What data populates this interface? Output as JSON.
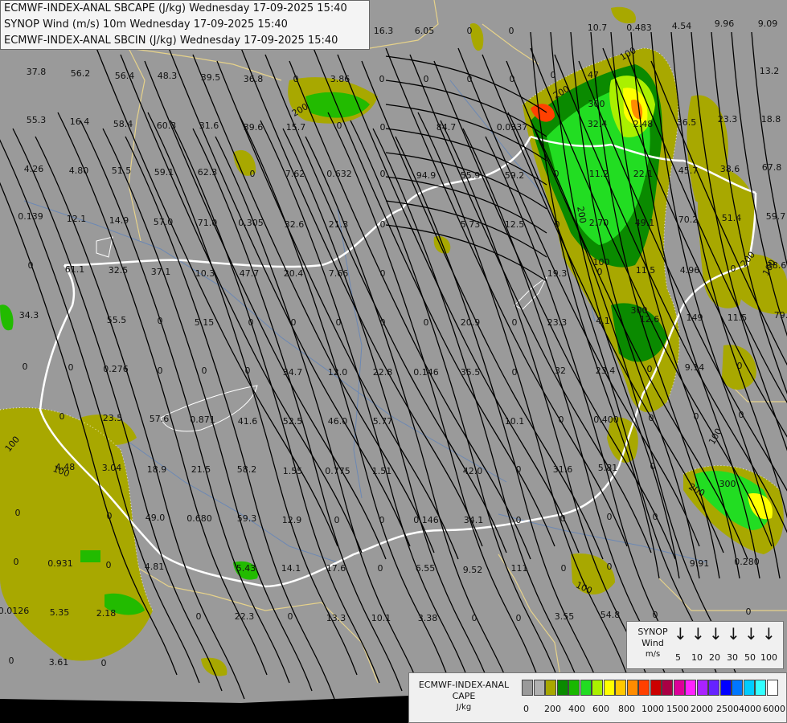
{
  "header": {
    "line1": "ECMWF-INDEX-ANAL SBCAPE (J/kg) Wednesday 17-09-2025 15:40",
    "line2": "SYNOP Wind (m/s) 10m Wednesday 17-09-2025 15:40",
    "line3": "ECMWF-INDEX-ANAL SBCIN (J/kg) Wednesday 17-09-2025 15:40"
  },
  "synop_legend": {
    "title_lines": [
      "SYNOP",
      "Wind",
      "m/s"
    ],
    "values": [
      "5",
      "10",
      "20",
      "30",
      "50",
      "100"
    ]
  },
  "cape_legend": {
    "title_lines": [
      "ECMWF-INDEX-ANAL",
      "CAPE",
      "J/kg"
    ],
    "ticks": [
      "0",
      "200",
      "400",
      "600",
      "800",
      "1000",
      "1500",
      "2000",
      "2500",
      "4000",
      "6000"
    ],
    "colors": [
      "#9a9a9a",
      "#b0b0b0",
      "#a8a800",
      "#0a8a00",
      "#19b800",
      "#22dd22",
      "#aaf000",
      "#ffff00",
      "#ffc800",
      "#ff8c00",
      "#ff4000",
      "#cc0000",
      "#aa0044",
      "#dd0099",
      "#ff22ff",
      "#aa22ff",
      "#6622ff",
      "#0000ff",
      "#0077ff",
      "#00ccff",
      "#33ffff",
      "#ffffff"
    ]
  },
  "colors": {
    "background": "#9a9a9a",
    "cape_low": "#a8a800",
    "cape_mid": "#22cc00",
    "cape_high": "#ffff00",
    "cape_peak": "#ff6600",
    "border": "#ffffff",
    "coast": "#e6d28a",
    "streamline": "#000000"
  },
  "map_labels": [
    "16.3",
    "6.05",
    "0",
    "0",
    "10.7",
    "0.483",
    "4.54",
    "9.96",
    "9.09",
    "37.8",
    "56.2",
    "56.4",
    "48.3",
    "39.5",
    "36.8",
    "0",
    "3.86",
    "0",
    "0",
    "0",
    "0",
    "0",
    "47",
    "13.2",
    "55.3",
    "16.4",
    "58.4",
    "60.3",
    "31.6",
    "39.6",
    "15.7",
    "0",
    "0",
    "84.7",
    "0.0337",
    "32.4",
    "2.48",
    "36.5",
    "23.3",
    "18.8",
    "4.26",
    "4.80",
    "51.5",
    "59.1",
    "62.3",
    "0",
    "7.62",
    "0.632",
    "0",
    "94.9",
    "55.9",
    "59.2",
    "0",
    "11.2",
    "22.1",
    "45.7",
    "38.6",
    "67.8",
    "0.139",
    "12.1",
    "14.9",
    "57.0",
    "71.0",
    "0.305",
    "32.6",
    "21.3",
    "0",
    "5.73",
    "12.5",
    "0",
    "2.70",
    "49.1",
    "70.2",
    "51.4",
    "59.7",
    "0",
    "61.1",
    "32.5",
    "37.1",
    "10.3",
    "47.7",
    "20.4",
    "7.66",
    "0",
    "19.3",
    "0",
    "11.5",
    "4.96",
    "0",
    "38.6",
    "34.3",
    "55.5",
    "0",
    "5.15",
    "0",
    "0",
    "0",
    "0",
    "0",
    "20.9",
    "0",
    "23.3",
    "4.1",
    "12.6",
    "149",
    "11.5",
    "79.2",
    "0",
    "0",
    "0.276",
    "0",
    "0",
    "0",
    "34.7",
    "12.0",
    "22.8",
    "0.146",
    "35.5",
    "0",
    "32",
    "23.4",
    "0",
    "9.14",
    "0",
    "0",
    "23.5",
    "57.6",
    "0.871",
    "41.6",
    "52.5",
    "46.0",
    "5.77",
    "10.1",
    "0",
    "0.400",
    "0",
    "0",
    "0",
    "4.48",
    "3.04",
    "18.9",
    "21.5",
    "58.2",
    "1.55",
    "0.775",
    "1.51",
    "42.0",
    "0",
    "31.6",
    "5.81",
    "0",
    "0",
    "0",
    "49.0",
    "0.680",
    "59.3",
    "12.9",
    "0",
    "0",
    "0.146",
    "34.1",
    "0",
    "0",
    "0",
    "0",
    "0",
    "0.931",
    "0",
    "4.81",
    "5.43",
    "14.1",
    "17.6",
    "0",
    "6.55",
    "9.52",
    "111",
    "0",
    "0",
    "9.91",
    "0.280",
    "0.0126",
    "5.35",
    "2.18",
    "0",
    "22.3",
    "0",
    "13.3",
    "10.1",
    "3.38",
    "0",
    "0",
    "3.55",
    "54.8",
    "0",
    "0",
    "0",
    "3.61",
    "0"
  ],
  "contour_labels": [
    "200",
    "100",
    "100",
    "100",
    "200",
    "300",
    "200",
    "100",
    "200",
    "300",
    "100",
    "300",
    "100",
    "200",
    "100"
  ]
}
